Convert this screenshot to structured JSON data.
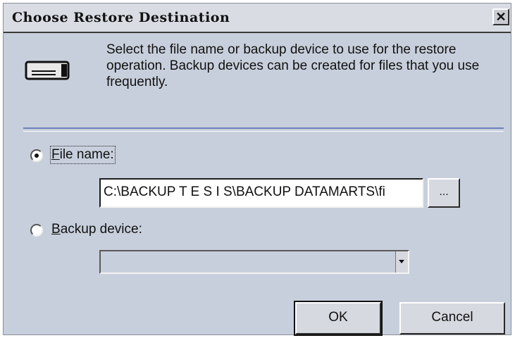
{
  "window": {
    "title": "Choose Restore Destination",
    "close_label": "✕"
  },
  "intro_text": "Select the file name or backup device to use for the restore operation.  Backup devices can be created for files that you use frequently.",
  "options": {
    "file_name": {
      "label_access": "F",
      "label_rest": "ile name:",
      "selected": true,
      "value": "C:\\BACKUP T E S I S\\BACKUP DATAMARTS\\fi",
      "browse_label": "..."
    },
    "backup_device": {
      "label_access": "B",
      "label_rest": "ackup device:",
      "selected": false,
      "value": ""
    }
  },
  "buttons": {
    "ok": "OK",
    "cancel": "Cancel"
  },
  "colors": {
    "dialog_bg": "#c8cfdc",
    "separator": "#6d7fbe"
  },
  "icons": [
    "device-icon",
    "radio-selected-icon",
    "radio-unselected-icon",
    "dropdown-arrow-icon"
  ]
}
